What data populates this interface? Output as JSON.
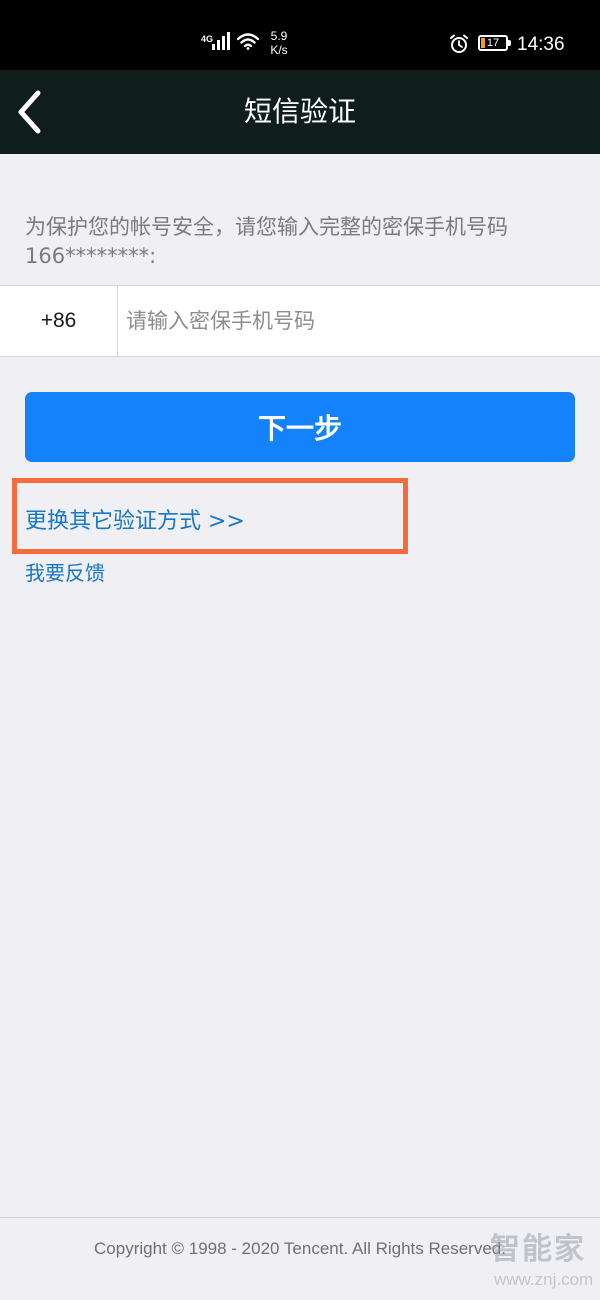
{
  "status_bar": {
    "network": "4G",
    "speed_value": "5.9",
    "speed_unit": "K/s",
    "battery_level": "17",
    "battery_fraction": 0.17,
    "time": "14:36",
    "icons": [
      "signal-icon",
      "wifi-icon",
      "alarm-icon",
      "battery-icon"
    ]
  },
  "nav": {
    "back_icon": "chevron-left-icon",
    "title": "短信验证"
  },
  "content": {
    "prompt_line1": "为保护您的帐号安全，请您输入完整的密保手机号码",
    "prompt_line2": "166********:",
    "country_code": "+86",
    "phone_value": "",
    "phone_placeholder": "请输入密保手机号码",
    "next_label": "下一步",
    "switch_method_label": "更换其它验证方式 >>",
    "feedback_label": "我要反馈"
  },
  "footer": {
    "copyright": "Copyright © 1998 - 2020 Tencent. All Rights Reserved."
  },
  "watermark": {
    "logo": "智能家",
    "url": "www.znj.com"
  },
  "colors": {
    "status_bar_bg": "#000000",
    "nav_bg": "#0f1d1b",
    "page_bg": "#efeff4",
    "primary_button": "#1482fa",
    "link": "#1478cc",
    "highlight": "#f46b3e",
    "battery_fill": "#f0a020"
  }
}
